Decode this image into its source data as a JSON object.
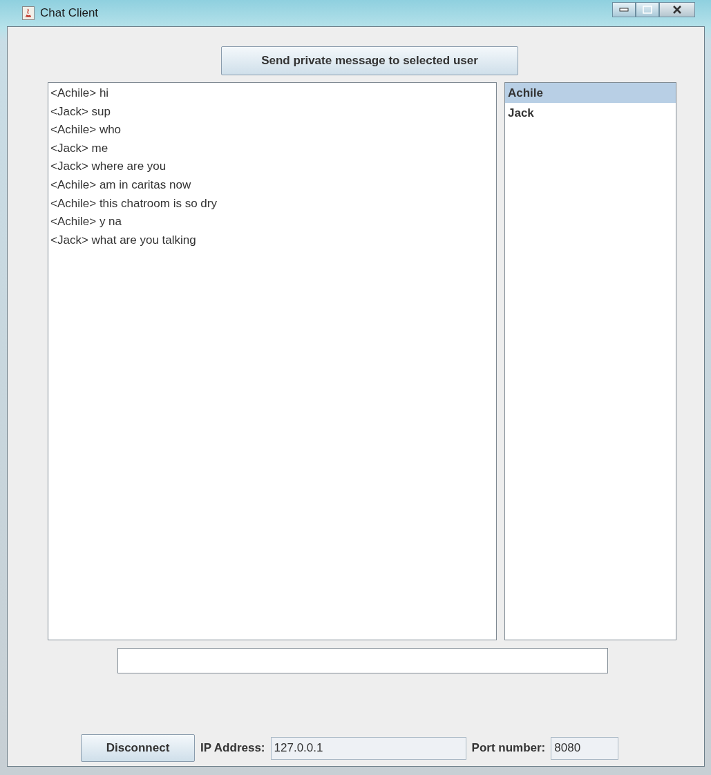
{
  "window": {
    "title": "Chat Client"
  },
  "private_message_button": {
    "label": "Send private message to selected user"
  },
  "messages": [
    "<Achile> hi",
    "<Jack> sup",
    "<Achile> who",
    "<Jack> me",
    "<Jack> where are you",
    "<Achile> am in caritas now",
    "<Achile> this chatroom is so dry",
    "<Achile> y na",
    "<Jack> what are you talking"
  ],
  "users": [
    {
      "name": "Achile",
      "selected": true
    },
    {
      "name": "Jack",
      "selected": false
    }
  ],
  "disconnect_button": {
    "label": "Disconnect"
  },
  "ip_address": {
    "label": "IP Address:",
    "value": "127.0.0.1"
  },
  "port": {
    "label": "Port number:",
    "value": "8080"
  }
}
